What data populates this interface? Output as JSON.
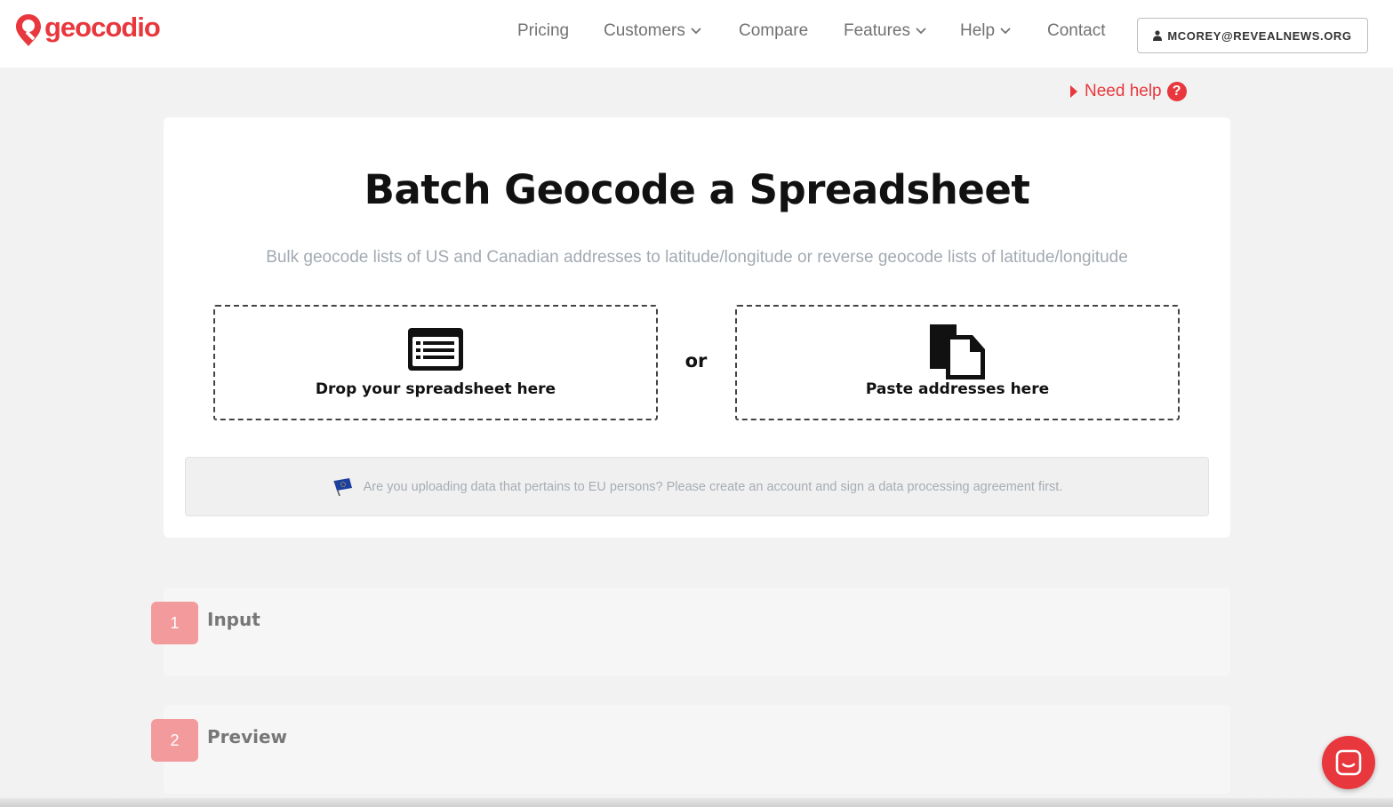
{
  "brand": {
    "name": "geocodio",
    "color": "#e8383d"
  },
  "nav": {
    "items": [
      {
        "label": "Pricing",
        "dropdown": false
      },
      {
        "label": "Customers",
        "dropdown": true
      },
      {
        "label": "Compare",
        "dropdown": false
      },
      {
        "label": "Features",
        "dropdown": true
      },
      {
        "label": "Help",
        "dropdown": true
      },
      {
        "label": "Contact",
        "dropdown": false
      }
    ],
    "account": "MCOREY@REVEALNEWS.ORG"
  },
  "help_link": "Need help",
  "main": {
    "title": "Batch Geocode a Spreadsheet",
    "subtitle": "Bulk geocode lists of US and Canadian addresses to latitude/longitude or reverse geocode lists of latitude/longitude",
    "drop_label": "Drop your spreadsheet here",
    "or_label": "or",
    "paste_label": "Paste addresses here",
    "eu_notice": "Are you uploading data that pertains to EU persons? Please create an account and sign a data processing agreement first."
  },
  "steps": [
    {
      "number": "1",
      "title": "Input"
    },
    {
      "number": "2",
      "title": "Preview"
    }
  ],
  "icons": {
    "logo": "map-pin-icon",
    "dropdown": "chevron-down-icon",
    "account": "user-icon",
    "help": "question-circle-icon",
    "drop": "spreadsheet-list-icon",
    "paste": "paste-documents-icon",
    "eu": "eu-flag-icon",
    "chat": "chat-icon"
  }
}
